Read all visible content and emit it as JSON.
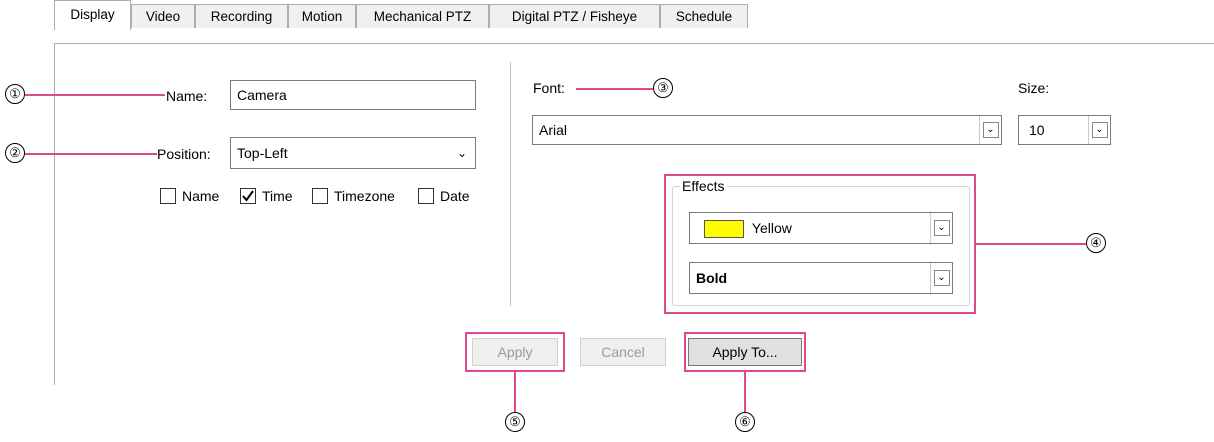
{
  "tabs": [
    "Display",
    "Video",
    "Recording",
    "Motion",
    "Mechanical PTZ",
    "Digital PTZ / Fisheye",
    "Schedule"
  ],
  "name_label": "Name:",
  "name_value": "Camera",
  "position_label": "Position:",
  "position_value": "Top-Left",
  "checkboxes": [
    {
      "label": "Name",
      "checked": false
    },
    {
      "label": "Time",
      "checked": true
    },
    {
      "label": "Timezone",
      "checked": false
    },
    {
      "label": "Date",
      "checked": false
    }
  ],
  "font_label": "Font:",
  "font_value": "Arial",
  "size_label": "Size:",
  "size_value": "10",
  "effects_title": "Effects",
  "color_value": "Yellow",
  "color_swatch": "#ffff00",
  "style_value": "Bold",
  "apply_label": "Apply",
  "cancel_label": "Cancel",
  "apply_to_label": "Apply To...",
  "callouts": [
    "①",
    "②",
    "③",
    "④",
    "⑤",
    "⑥"
  ],
  "callout_color": "#e0488f"
}
